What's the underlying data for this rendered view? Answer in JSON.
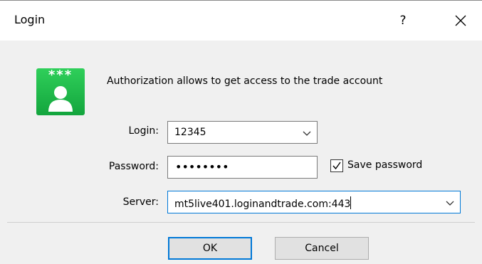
{
  "window": {
    "title": "Login",
    "help_glyph": "?",
    "close_icon": "close-icon"
  },
  "header": {
    "icon": "user-key-icon",
    "icon_stars": "***",
    "message": "Authorization allows to get access to the trade account"
  },
  "form": {
    "login": {
      "label": "Login:",
      "value": "12345"
    },
    "password": {
      "label": "Password:",
      "value": "••••••••"
    },
    "save_password": {
      "label": "Save password",
      "checked": true
    },
    "server": {
      "label": "Server:",
      "value": "mt5live401.loginandtrade.com:443"
    }
  },
  "buttons": {
    "ok": "OK",
    "cancel": "Cancel"
  },
  "colors": {
    "accent": "#0078d7",
    "icon_green": "#1db84a"
  }
}
